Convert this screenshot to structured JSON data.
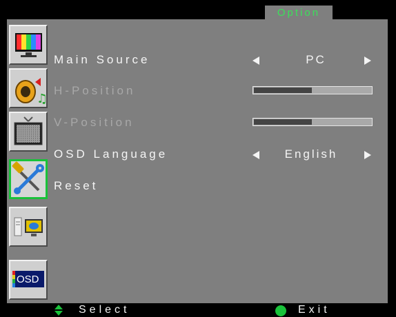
{
  "header": {
    "title": "Option"
  },
  "sidebar": {
    "items": [
      {
        "icon": "color-bars-icon"
      },
      {
        "icon": "audio-icon"
      },
      {
        "icon": "screen-icon"
      },
      {
        "icon": "tools-icon",
        "active": true
      },
      {
        "icon": "pc-icon"
      },
      {
        "icon": "osd-icon",
        "label": "OSD"
      }
    ]
  },
  "menu": {
    "main_source": {
      "label": "Main Source",
      "value": "PC"
    },
    "h_position": {
      "label": "H-Position",
      "level_pct": 50
    },
    "v_position": {
      "label": "V-Position",
      "level_pct": 50
    },
    "osd_language": {
      "label": "OSD Language",
      "value": "English"
    },
    "reset": {
      "label": "Reset"
    }
  },
  "footer": {
    "select_label": "Select",
    "exit_label": "Exit"
  },
  "colors": {
    "background": "#7f7f7f",
    "accent_green": "#19c23a",
    "text": "#f4f4f4",
    "disabled_text": "#a8a8a8"
  }
}
